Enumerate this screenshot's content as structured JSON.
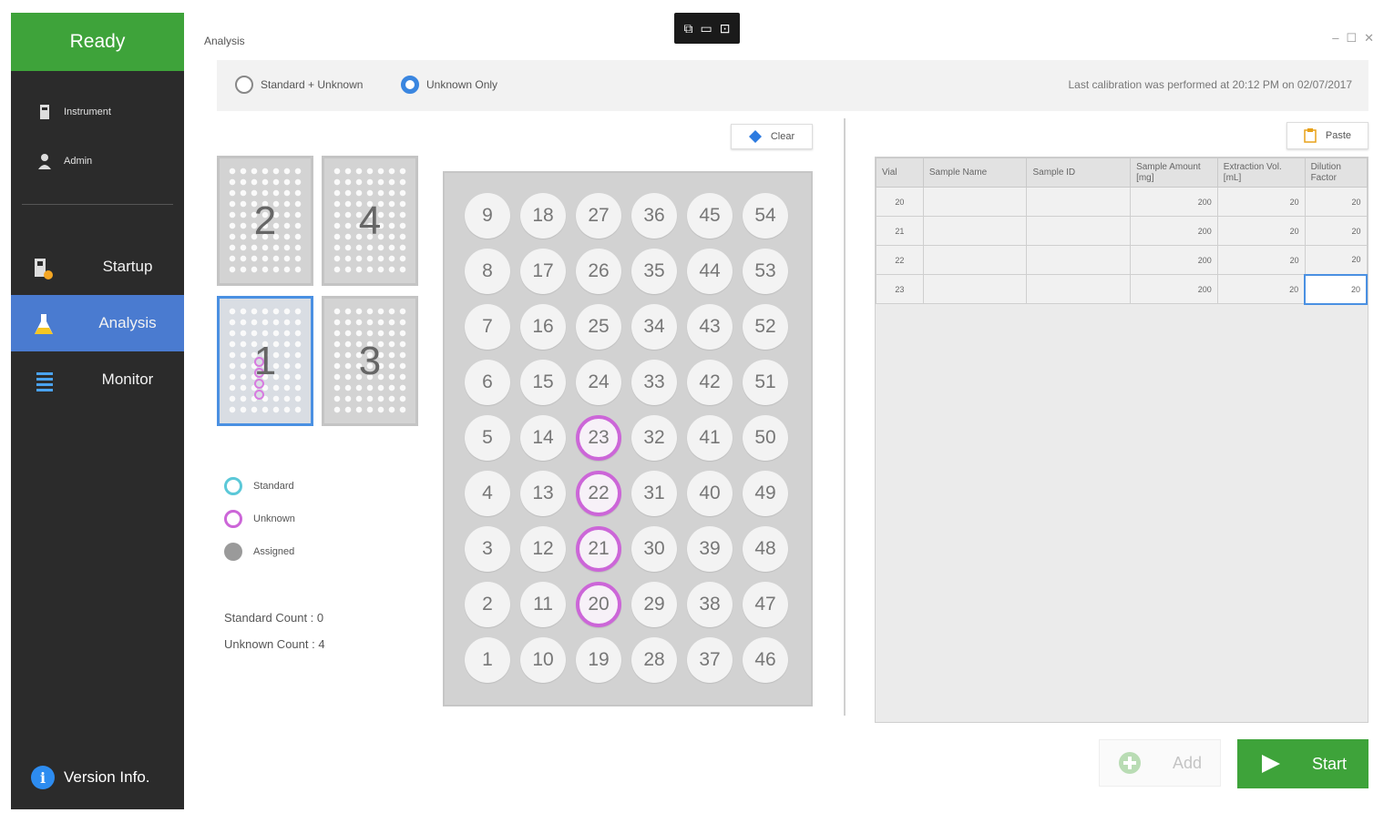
{
  "sidebar": {
    "status": "Ready",
    "small_items": [
      {
        "label": "Instrument",
        "icon": "instrument-icon"
      },
      {
        "label": "Admin",
        "icon": "user-icon"
      }
    ],
    "nav": [
      {
        "label": "Startup",
        "icon": "startup-icon",
        "active": false
      },
      {
        "label": "Analysis",
        "icon": "flask-icon",
        "active": true
      },
      {
        "label": "Monitor",
        "icon": "list-icon",
        "active": false
      }
    ],
    "version_label": "Version Info."
  },
  "window": {
    "title": "Analysis",
    "controls": [
      "–",
      "☐",
      "✕"
    ]
  },
  "mode": {
    "option1": "Standard + Unknown",
    "option2": "Unknown Only",
    "selected": "Unknown Only",
    "calibration": "Last calibration was performed at 20:12 PM on 02/07/2017"
  },
  "trays": [
    {
      "label": "2",
      "selected": false
    },
    {
      "label": "4",
      "selected": false
    },
    {
      "label": "1",
      "selected": true
    },
    {
      "label": "3",
      "selected": false
    }
  ],
  "legend": {
    "standard": "Standard",
    "unknown": "Unknown",
    "assigned": "Assigned"
  },
  "counts": {
    "standard": "Standard Count : 0",
    "unknown": "Unknown Count : 4"
  },
  "buttons": {
    "clear": "Clear",
    "paste": "Paste",
    "add": "Add",
    "start": "Start"
  },
  "vials": {
    "rows": [
      [
        9,
        18,
        27,
        36,
        45,
        54
      ],
      [
        8,
        17,
        26,
        35,
        44,
        53
      ],
      [
        7,
        16,
        25,
        34,
        43,
        52
      ],
      [
        6,
        15,
        24,
        33,
        42,
        51
      ],
      [
        5,
        14,
        23,
        32,
        41,
        50
      ],
      [
        4,
        13,
        22,
        31,
        40,
        49
      ],
      [
        3,
        12,
        21,
        30,
        39,
        48
      ],
      [
        2,
        11,
        20,
        29,
        38,
        47
      ],
      [
        1,
        10,
        19,
        28,
        37,
        46
      ]
    ],
    "unknown": [
      20,
      21,
      22,
      23
    ]
  },
  "table": {
    "headers": [
      "Vial",
      "Sample Name",
      "Sample ID",
      "Sample Amount [mg]",
      "Extraction Vol. [mL]",
      "Dilution Factor"
    ],
    "rows": [
      [
        "20",
        "",
        "",
        "200",
        "20",
        "20"
      ],
      [
        "21",
        "",
        "",
        "200",
        "20",
        "20"
      ],
      [
        "22",
        "",
        "",
        "200",
        "20",
        "20"
      ],
      [
        "23",
        "",
        "",
        "200",
        "20",
        "20"
      ]
    ]
  },
  "colors": {
    "accent_green": "#3ea33a",
    "nav_active": "#4a7bd0",
    "unknown_ring": "#cc66d8",
    "standard_ring": "#5bc8d8"
  }
}
